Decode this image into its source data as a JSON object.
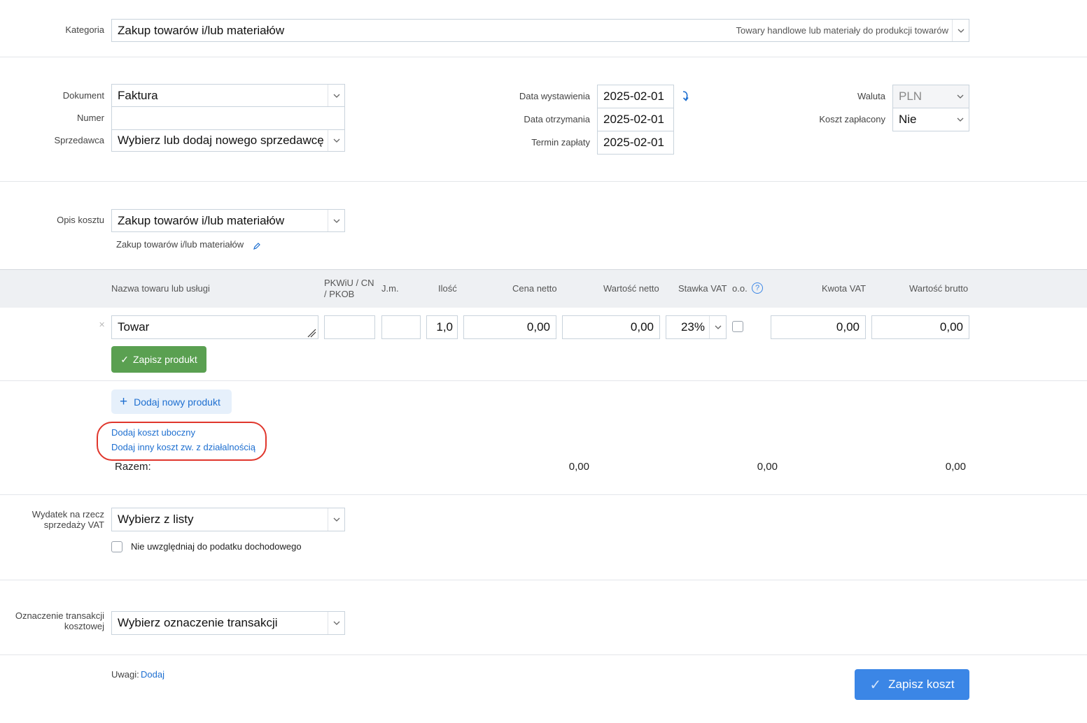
{
  "kategoria": {
    "label": "Kategoria",
    "value": "Zakup towarów i/lub materiałów",
    "hint": "Towary handlowe lub materiały do produkcji towarów"
  },
  "dokument": {
    "dokument_label": "Dokument",
    "dokument_value": "Faktura",
    "numer_label": "Numer",
    "numer_value": "",
    "sprzedawca_label": "Sprzedawca",
    "sprzedawca_value": "Wybierz lub dodaj nowego sprzedawcę"
  },
  "daty": {
    "wystawienia_label": "Data wystawienia",
    "wystawienia_value": "2025-02-01",
    "otrzymania_label": "Data otrzymania",
    "otrzymania_value": "2025-02-01",
    "termin_label": "Termin zapłaty",
    "termin_value": "2025-02-01"
  },
  "waluta": {
    "waluta_label": "Waluta",
    "waluta_value": "PLN",
    "zaplacony_label": "Koszt zapłacony",
    "zaplacony_value": "Nie"
  },
  "opis": {
    "label": "Opis kosztu",
    "value": "Zakup towarów i/lub materiałów",
    "subtext": "Zakup towarów i/lub materiałów"
  },
  "table": {
    "headers": {
      "nazwa": "Nazwa towaru lub usługi",
      "pkwiu_line1": "PKWiU / CN",
      "pkwiu_line2": "/ PKOB",
      "jm": "J.m.",
      "ilosc": "Ilość",
      "cena": "Cena netto",
      "wartosc_netto": "Wartość netto",
      "stawka": "Stawka VAT",
      "oo": "o.o.",
      "kwota_vat": "Kwota VAT",
      "wartosc_brutto": "Wartość brutto"
    },
    "row": {
      "nazwa": "Towar",
      "pkwiu": "",
      "jm": "",
      "ilosc": "1,0",
      "cena": "0,00",
      "wartosc_netto": "0,00",
      "stawka": "23%",
      "kwota_vat": "0,00",
      "wartosc_brutto": "0,00"
    },
    "save_product_label": "Zapisz produkt",
    "add_product_label": "Dodaj nowy produkt",
    "add_side_cost_label": "Dodaj koszt uboczny",
    "add_other_cost_label": "Dodaj inny koszt zw. z działalnością",
    "razem_label": "Razem:",
    "razem_netto": "0,00",
    "razem_vat": "0,00",
    "razem_brutto": "0,00"
  },
  "wydatek": {
    "label_line1": "Wydatek na rzecz",
    "label_line2": "sprzedaży VAT",
    "value": "Wybierz z listy",
    "checkbox_label": "Nie uwzględniaj do podatku dochodowego"
  },
  "oznaczenie": {
    "label_line1": "Oznaczenie transakcji",
    "label_line2": "kosztowej",
    "value": "Wybierz oznaczenie transakcji"
  },
  "footer": {
    "uwagi_label": "Uwagi:",
    "uwagi_link": "Dodaj",
    "submit_label": "Zapisz koszt"
  },
  "colors": {
    "accent_blue": "#3b86e6",
    "link_blue": "#1e6fd0",
    "green": "#5aa051",
    "annotation_red": "#e0362c",
    "table_header_bg": "#eef0f3"
  }
}
